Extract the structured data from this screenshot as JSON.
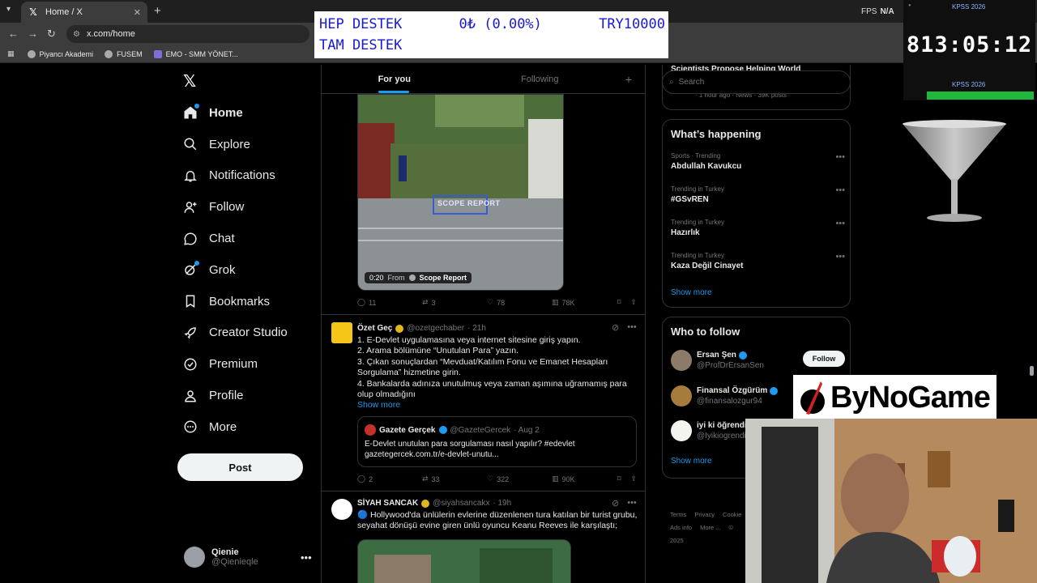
{
  "browser": {
    "tab_title": "Home / X",
    "url": "x.com/home",
    "bookmarks": [
      "Piyancı Akademi",
      "FUSEM",
      "EMO - SMM YÖNET..."
    ],
    "fps_label": "FPS",
    "fps_value": "N/A"
  },
  "ticker": {
    "line1_left": "HEP DESTEK",
    "line1_mid": "0₺ (0.00%)",
    "line1_right": "TRY10000",
    "line2_left": "TAM DESTEK"
  },
  "timer": {
    "label_top": "KPSS 2026",
    "digits": "813:05:12",
    "label_bottom": "KPSS 2026",
    "progress_fraction": 0.85
  },
  "sponsor": {
    "text": "ByNoGame"
  },
  "sidebar": {
    "items": [
      {
        "label": "Home",
        "icon": "home-icon"
      },
      {
        "label": "Explore",
        "icon": "search-icon"
      },
      {
        "label": "Notifications",
        "icon": "bell-icon"
      },
      {
        "label": "Follow",
        "icon": "person-add-icon"
      },
      {
        "label": "Chat",
        "icon": "chat-icon"
      },
      {
        "label": "Grok",
        "icon": "grok-icon"
      },
      {
        "label": "Bookmarks",
        "icon": "bookmark-icon"
      },
      {
        "label": "Creator Studio",
        "icon": "rocket-icon"
      },
      {
        "label": "Premium",
        "icon": "verified-icon"
      },
      {
        "label": "Profile",
        "icon": "profile-icon"
      },
      {
        "label": "More",
        "icon": "more-icon"
      }
    ],
    "post_label": "Post",
    "account_name": "Qienie",
    "account_handle": "@Qienieqle"
  },
  "timeline": {
    "tabs": [
      "For you",
      "Following"
    ],
    "video": {
      "duration": "0:20",
      "from_label": "From",
      "source": "Scope Report",
      "watermark": "SCOPE REPORT"
    },
    "tweet1_actions": {
      "replies": "11",
      "reposts": "3",
      "likes": "78",
      "views": "78K"
    },
    "tweet2": {
      "name": "Özet Geç",
      "handle": "@ozetgechaber",
      "time": "· 21h",
      "lines": [
        "1. E-Devlet uygulamasına veya internet sitesine giriş yapın.",
        "2. Arama bölümüne “Unutulan Para” yazın.",
        "3. Çıkan sonuçlardan “Mevduat/Katılım Fonu ve Emanet Hesapları Sorgulama” hizmetine girin.",
        "4. Bankalarda adınıza unutulmuş veya zaman aşımına uğramamış para olup olmadığını"
      ],
      "show_more": "Show more",
      "quote": {
        "name": "Gazete Gerçek",
        "handle": "@GazeteGercek",
        "time": "· Aug 2",
        "text": "E-Devlet unutulan para sorgulaması nasıl yapılır? #edevlet gazetegercek.com.tr/e-devlet-unutu..."
      },
      "actions": {
        "replies": "2",
        "reposts": "33",
        "likes": "322",
        "views": "90K"
      }
    },
    "tweet3": {
      "name": "SİYAH SANCAK",
      "handle": "@siyahsancakx",
      "time": "· 19h",
      "text": "🔵 Hollywood'da ünlülerin evlerine düzenlenen tura katılan bir turist grubu, seyahat dönüşü evine giren ünlü oyuncu Keanu Reeves ile karşılaştı;"
    }
  },
  "right": {
    "search_placeholder": "Search",
    "peek_top": "Scientists Propose Helping World",
    "peek_bottom": "· 1 hour ago · News · 39K posts",
    "happening_title": "What’s happening",
    "trends": [
      {
        "category": "Sports · Trending",
        "name": "Abdullah Kavukcu"
      },
      {
        "category": "Trending in Turkey",
        "name": "#GSvREN"
      },
      {
        "category": "Trending in Turkey",
        "name": "Hazırlık"
      },
      {
        "category": "Trending in Turkey",
        "name": "Kaza Değil Cinayet"
      }
    ],
    "show_more": "Show more",
    "wtf_title": "Who to follow",
    "follow": [
      {
        "name": "Ersan Şen",
        "handle": "@ProfDrErsanSen",
        "badge": "blue"
      },
      {
        "name": "Finansal Özgürüm",
        "handle": "@finansalozgur94",
        "badge": "blue"
      },
      {
        "name": "iyi ki öğrendim",
        "handle": "@Iyikiogrendim",
        "badge": "none"
      }
    ],
    "follow_label": "Follow",
    "wtf_show_more": "Show more",
    "footer": [
      "Terms",
      "Privacy",
      "Cookie",
      "Ads info",
      "More ...",
      "© 2025"
    ]
  },
  "colors": {
    "accent": "#1d9bf0",
    "background": "#000000",
    "border": "#2f3336",
    "muted": "#71767b",
    "gold_badge": "#e2b719"
  }
}
